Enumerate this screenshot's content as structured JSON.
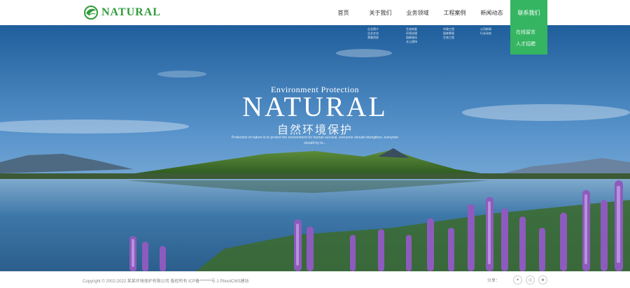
{
  "logo": {
    "text": "NATURAL"
  },
  "nav": [
    {
      "label": "首页",
      "active": false
    },
    {
      "label": "关于我们",
      "active": false
    },
    {
      "label": "业务领域",
      "active": false
    },
    {
      "label": "工程案例",
      "active": false
    },
    {
      "label": "新闻动态",
      "active": false
    },
    {
      "label": "联系我们",
      "active": true
    }
  ],
  "submenus": {
    "about": [
      "企业简介",
      "企业文化",
      "荣誉资质"
    ],
    "business": [
      "生态修复",
      "环境治理",
      "园林绿化",
      "水土保持"
    ],
    "cases": [
      "市政工程",
      "园林景观",
      "生态工程"
    ],
    "news": [
      "公司新闻",
      "行业动态"
    ],
    "contact": [
      "在线留言",
      "人才招聘"
    ]
  },
  "hero": {
    "subtitle": "Environment Protection",
    "title": "NATURAL",
    "title_cn": "自然环境保护",
    "description": "Protection of nature is to protect the environment for human survival, everyone should strengthen, everyone should try to..."
  },
  "footer": {
    "copyright": "Copyright © 2002-2022 某某环境保护有限公司 版权所有 ICP备*******号-1 PbootCMS建站",
    "share_label": "分享："
  },
  "colors": {
    "accent": "#35b561",
    "logo": "#2e9b3a"
  }
}
